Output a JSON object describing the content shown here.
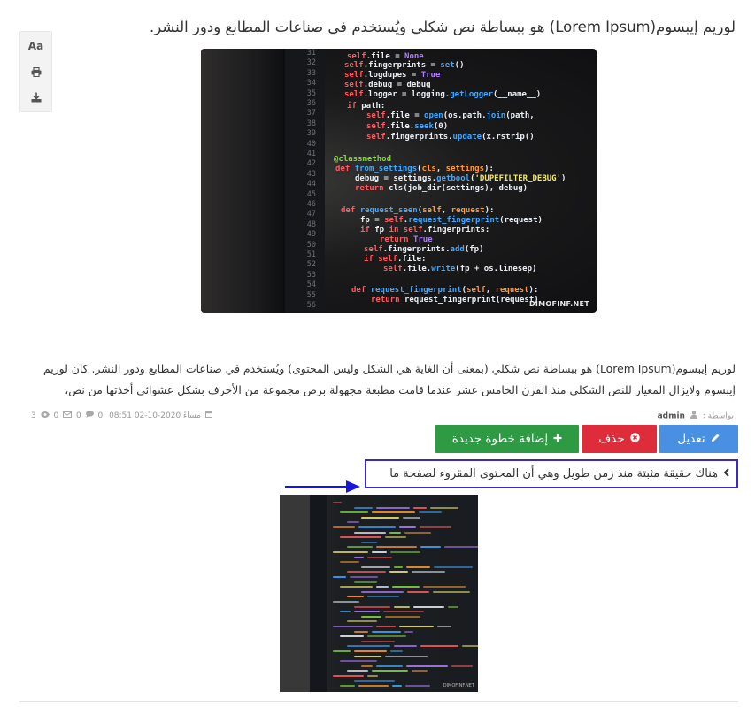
{
  "article": {
    "title": "لوريم إيبسوم(Lorem Ipsum) هو ببساطة نص شكلي ويُستخدم في صناعات المطابع ودور النشر.",
    "body": "لوريم إيبسوم(Lorem Ipsum) هو ببساطة نص شكلي (بمعنى أن الغاية هي الشكل وليس المحتوى) ويُستخدم في صناعات المطابع ودور النشر. كان لوريم إيبسوم ولايزال المعيار للنص الشكلي منذ القرن الخامس عشر عندما قامت مطبعة مجهولة برص مجموعة من الأحرف بشكل عشوائي أخذتها من نص،"
  },
  "tools": [
    {
      "label": "Aa",
      "icon": "font-size-icon"
    },
    {
      "label": "",
      "icon": "print-icon"
    },
    {
      "label": "",
      "icon": "download-icon"
    }
  ],
  "hero_image": {
    "watermark": "DIMOFINF.NET",
    "line_numbers": [
      "31",
      "32",
      "33",
      "34",
      "35",
      "36",
      "37",
      "38",
      "39",
      "40",
      "41",
      "42",
      "43",
      "44",
      "45",
      "46",
      "47",
      "48",
      "49",
      "50",
      "51",
      "52",
      "53",
      "54",
      "55",
      "56"
    ]
  },
  "meta": {
    "by_label": "بواسطة :",
    "author": "admin",
    "date": "08:51 02-10-2020 مساءً",
    "comments": "0",
    "emails": "0",
    "views": "0",
    "shares": "3"
  },
  "actions": {
    "edit_label": "تعديل",
    "delete_label": "حذف",
    "add_label": "إضافة خطوة جديدة"
  },
  "step": {
    "text": "هناك حقيقة مثبتة منذ زمن طويل وهي أن المحتوى المقروء لصفحة ما"
  },
  "colors": {
    "edit": "#4a90e2",
    "delete": "#dd2c3a",
    "add": "#2e9a44",
    "step_border": "#3a2bc4",
    "arrow": "#1616e0"
  }
}
